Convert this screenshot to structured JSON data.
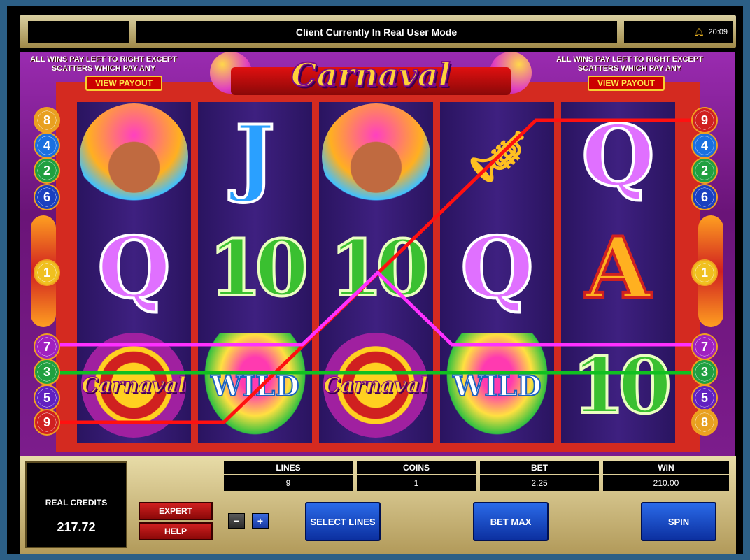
{
  "top_bar": {
    "left": "",
    "mode_text": "Client Currently In Real User Mode",
    "clock": "20:09"
  },
  "header": {
    "left_rule": "ALL WINS PAY LEFT TO RIGHT EXCEPT SCATTERS WHICH PAY ANY",
    "right_rule": "ALL WINS PAY LEFT TO RIGHT EXCEPT SCATTERS WHICH PAY ANY",
    "view_payout_left": "VIEW PAYOUT",
    "view_payout_right": "VIEW PAYOUT",
    "logo": "Carnaval"
  },
  "reels": [
    {
      "symbols": [
        "carnival-girl",
        "Q",
        "Carnaval"
      ]
    },
    {
      "symbols": [
        "J",
        "10",
        "WILD"
      ]
    },
    {
      "symbols": [
        "carnival-girl",
        "10",
        "Carnaval"
      ]
    },
    {
      "symbols": [
        "trumpet",
        "Q",
        "WILD"
      ]
    },
    {
      "symbols": [
        "Q",
        "A",
        "10"
      ]
    }
  ],
  "left_badges": [
    "8",
    "4",
    "2",
    "6",
    "1",
    "7",
    "3",
    "5",
    "9"
  ],
  "right_badges": [
    "9",
    "4",
    "2",
    "6",
    "1",
    "7",
    "3",
    "5",
    "8"
  ],
  "badge_colors": {
    "8": "#e8a020",
    "4": "#1a70e0",
    "2": "#20a040",
    "6": "#1a40c0",
    "1": "#f0c020",
    "7": "#a020c0",
    "3": "#20a040",
    "5": "#6020c0",
    "9": "#d02020"
  },
  "win_lines": [
    {
      "id": "9",
      "color": "#ff1010"
    },
    {
      "id": "7",
      "color": "#ff30ff"
    },
    {
      "id": "3",
      "color": "#10c020"
    }
  ],
  "panel": {
    "credits_label": "REAL CREDITS",
    "credits_value": "217.72",
    "lines_label": "LINES",
    "lines_value": "9",
    "coins_label": "COINS",
    "coins_value": "1",
    "bet_label": "BET",
    "bet_value": "2.25",
    "win_label": "WIN",
    "win_value": "210.00",
    "expert": "EXPERT",
    "help": "HELP",
    "minus": "−",
    "plus": "+",
    "select_lines": "SELECT LINES",
    "bet_max": "BET MAX",
    "spin": "SPIN"
  }
}
